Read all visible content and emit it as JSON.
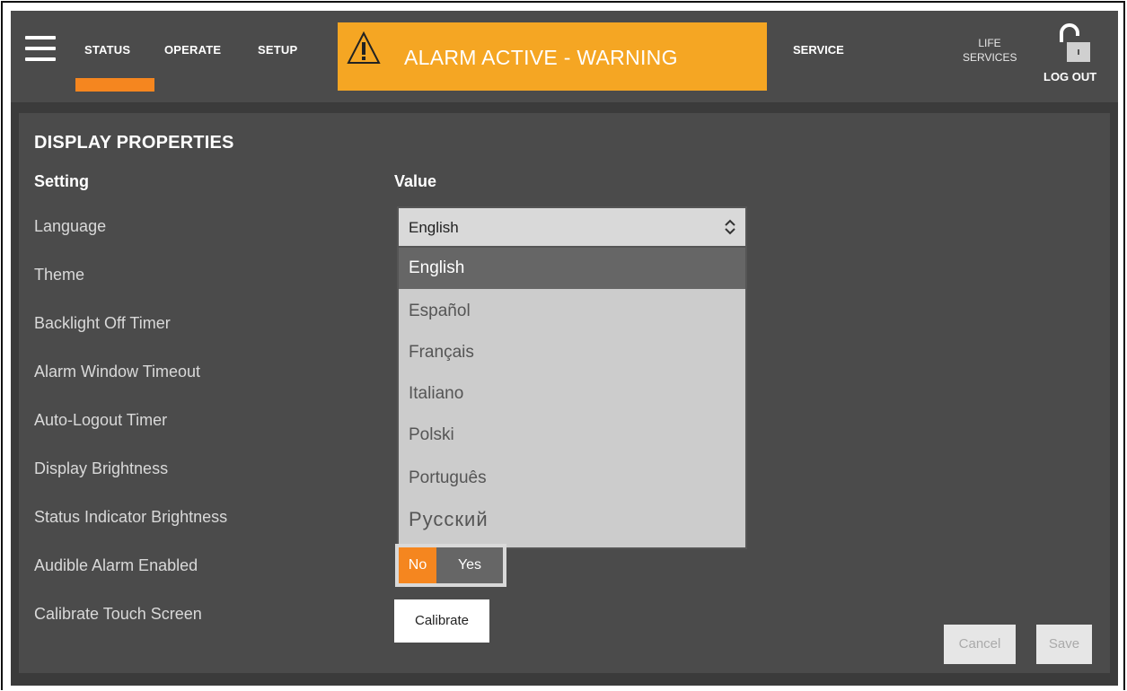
{
  "nav": {
    "tabs": [
      {
        "label": "STATUS",
        "active": true
      },
      {
        "label": "OPERATE",
        "active": false
      },
      {
        "label": "SETUP",
        "active": false
      }
    ],
    "alarm": {
      "text": "ALARM ACTIVE - WARNING",
      "icon": "warning-triangle-icon",
      "color": "#f5a623"
    },
    "service": "SERVICE",
    "life_services": [
      "LIFE",
      "SERVICES"
    ],
    "logout": "LOG OUT",
    "lock_icon": "unlocked-padlock-icon",
    "accent_color": "#f5861f"
  },
  "panel": {
    "title": "DISPLAY PROPERTIES",
    "headers": {
      "setting": "Setting",
      "value": "Value"
    },
    "settings": [
      "Language",
      "Theme",
      "Backlight Off Timer",
      "Alarm Window Timeout",
      "Auto-Logout Timer",
      "Display Brightness",
      "Status Indicator Brightness",
      "Audible Alarm Enabled",
      "Calibrate Touch Screen"
    ],
    "language": {
      "selected": "English",
      "options": [
        "English",
        "Español",
        "Français",
        "Italiano",
        "Polski",
        "Português",
        "Русский"
      ],
      "highlighted": "English"
    },
    "audible_alarm": {
      "options": [
        "No",
        "Yes"
      ],
      "selected": "No"
    },
    "calibrate_label": "Calibrate",
    "cancel_label": "Cancel",
    "save_label": "Save"
  }
}
